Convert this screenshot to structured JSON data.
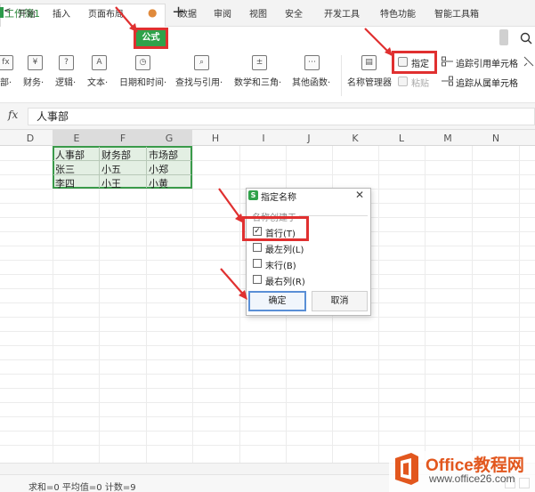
{
  "titlebar": {
    "doc_title": "工作簿1",
    "new_tab": "+"
  },
  "menu": {
    "back_chevron": "<",
    "tabs": [
      "开始",
      "插入",
      "页面布局",
      "公式",
      "数据",
      "审阅",
      "视图",
      "安全",
      "开发工具",
      "特色功能",
      "智能工具箱"
    ],
    "search_icon": "search-icon"
  },
  "ribbon": {
    "groups": [
      "部·",
      "财务·",
      "逻辑·",
      "文本·",
      "日期和时间·",
      "查找与引用·",
      "数学和三角·",
      "其他函数·",
      "名称管理器"
    ],
    "define": "指定",
    "paste": "粘贴",
    "trace_precedents": "追踪引用单元格",
    "trace_dependents": "追踪从属单元格"
  },
  "formula_bar": {
    "fx": "fx",
    "value": "人事部"
  },
  "grid": {
    "columns": [
      "D",
      "E",
      "F",
      "G",
      "H",
      "I",
      "J",
      "K",
      "L",
      "M",
      "N"
    ],
    "cells": [
      [
        "人事部",
        "财务部",
        "市场部"
      ],
      [
        "张三",
        "小五",
        "小郑"
      ],
      [
        "李四",
        "小王",
        "小黄"
      ]
    ]
  },
  "dialog": {
    "title": "指定名称",
    "close": "✕",
    "group_label": "名称创建于",
    "options": [
      {
        "label": "首行(T)",
        "checked": true
      },
      {
        "label": "最左列(L)",
        "checked": false
      },
      {
        "label": "末行(B)",
        "checked": false
      },
      {
        "label": "最右列(R)",
        "checked": false
      }
    ],
    "ok": "确定",
    "cancel": "取消"
  },
  "status": {
    "text": "求和=0  平均值=0  计数=9"
  },
  "watermark": {
    "brand": "Office教程网",
    "url": "www.office26.com"
  },
  "colors": {
    "accent_green": "#2fa24a",
    "highlight_red": "#e03030",
    "selection_green": "#3a9a4a",
    "brand_orange": "#e2571e"
  }
}
